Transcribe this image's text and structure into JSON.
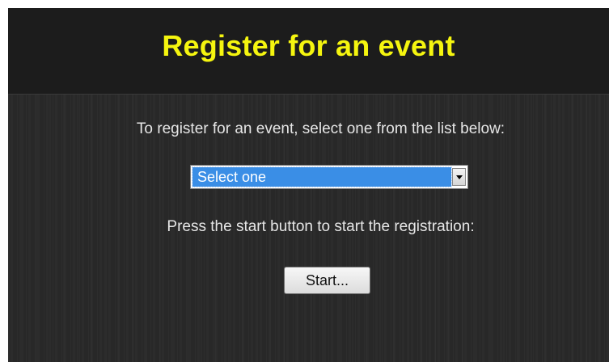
{
  "header": {
    "title": "Register for an event"
  },
  "form": {
    "select_instruction": "To register for an event, select one from the list below:",
    "event_select": {
      "selected_value": "Select one",
      "arrow_icon": "chevron-down-icon"
    },
    "start_instruction": "Press the start button to start the registration:",
    "start_button_label": "Start..."
  },
  "colors": {
    "title": "#f5f50f",
    "background": "#2a2a2a",
    "header_background": "#1c1c1c",
    "select_highlight": "#3a8ee6",
    "text": "#e6e6e6"
  }
}
